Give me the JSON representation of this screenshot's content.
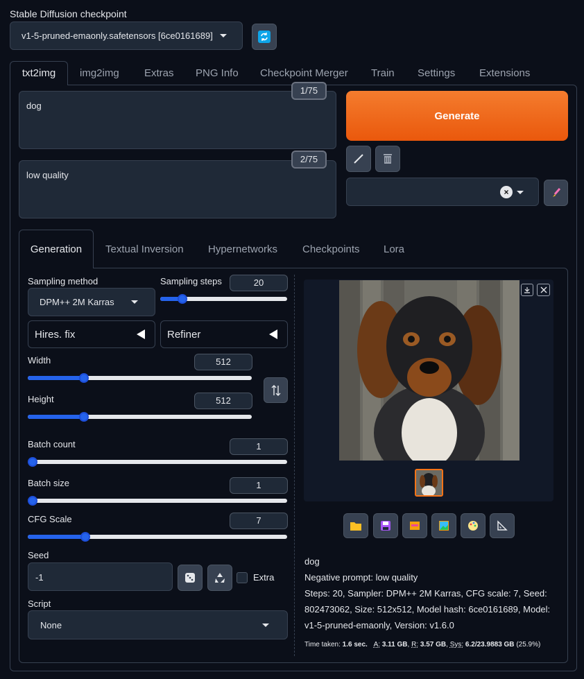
{
  "checkpoint": {
    "label": "Stable Diffusion checkpoint",
    "value": "v1-5-pruned-emaonly.safetensors [6ce0161689]"
  },
  "main_tabs": [
    "txt2img",
    "img2img",
    "Extras",
    "PNG Info",
    "Checkpoint Merger",
    "Train",
    "Settings",
    "Extensions"
  ],
  "prompt": {
    "text": "dog",
    "token_count": "1/75"
  },
  "negative_prompt": {
    "text": "low quality",
    "token_count": "2/75"
  },
  "generate_label": "Generate",
  "sub_tabs": [
    "Generation",
    "Textual Inversion",
    "Hypernetworks",
    "Checkpoints",
    "Lora"
  ],
  "sampling": {
    "method_label": "Sampling method",
    "method_value": "DPM++ 2M Karras",
    "steps_label": "Sampling steps",
    "steps_value": "20",
    "steps_fraction": 0.15
  },
  "hires_label": "Hires. fix",
  "refiner_label": "Refiner",
  "width": {
    "label": "Width",
    "value": "512",
    "fraction": 0.24
  },
  "height": {
    "label": "Height",
    "value": "512",
    "fraction": 0.24
  },
  "batch_count": {
    "label": "Batch count",
    "value": "1",
    "fraction": 0.0
  },
  "batch_size": {
    "label": "Batch size",
    "value": "1",
    "fraction": 0.0
  },
  "cfg": {
    "label": "CFG Scale",
    "value": "7",
    "fraction": 0.21
  },
  "seed": {
    "label": "Seed",
    "value": "-1",
    "extra_label": "Extra"
  },
  "script": {
    "label": "Script",
    "value": "None"
  },
  "output": {
    "prompt": "dog",
    "negative": "Negative prompt: low quality",
    "params": "Steps: 20, Sampler: DPM++ 2M Karras, CFG scale: 7, Seed: 802473062, Size: 512x512, Model hash: 6ce0161689, Model: v1-5-pruned-emaonly, Version: v1.6.0",
    "time_label": "Time taken:",
    "time_value": "1.6 sec.",
    "a_label": "A:",
    "a_value": "3.11 GB",
    "r_label": "R:",
    "r_value": "3.57 GB",
    "sys_label": "Sys:",
    "sys_value": "6.2/23.9883 GB",
    "sys_pct": "(25.9%)"
  },
  "colors": {
    "accent": "#f97316",
    "slider": "#2563eb",
    "background": "#0b0f19",
    "panel": "#1f2937"
  },
  "icons": [
    "refresh-icon",
    "pencil-icon",
    "trash-icon",
    "paintbrush-icon",
    "swap-icon",
    "dice-icon",
    "recycle-icon",
    "folder-icon",
    "save-icon",
    "zip-icon",
    "image-icon",
    "palette-icon",
    "ruler-icon",
    "download-icon",
    "close-icon"
  ]
}
